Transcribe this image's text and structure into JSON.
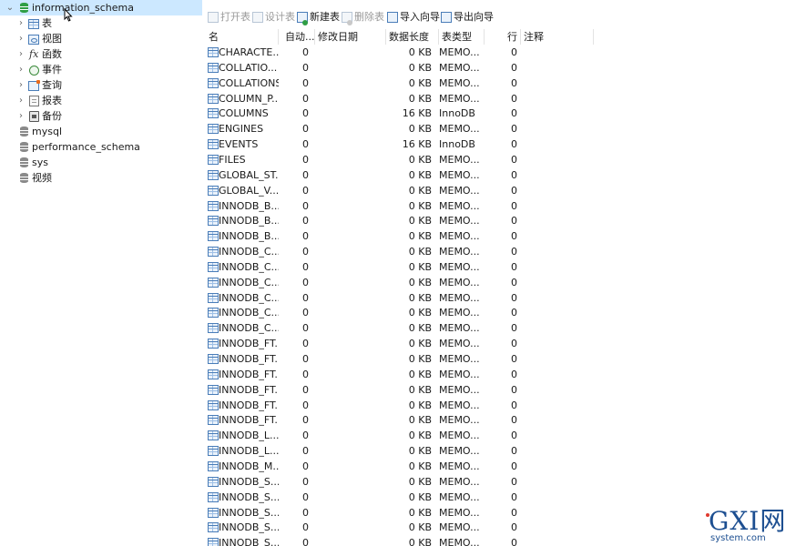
{
  "sidebar": {
    "root": "information_schema",
    "children": [
      "表",
      "视图",
      "函数",
      "事件",
      "查询",
      "报表",
      "备份"
    ],
    "databases": [
      "mysql",
      "performance_schema",
      "sys",
      "视频"
    ]
  },
  "toolbar": {
    "open_table": "打开表",
    "design_table": "设计表",
    "new_table": "新建表",
    "delete_table": "删除表",
    "import_wizard": "导入向导",
    "export_wizard": "导出向导"
  },
  "grid": {
    "columns": {
      "name": "名",
      "auto_increment": "自动...",
      "modified_date": "修改日期",
      "data_length": "数据长度",
      "engine": "表类型",
      "rows": "行",
      "comment": "注释"
    },
    "rows": [
      {
        "name": "CHARACTE...",
        "auto": "0",
        "size": "0 KB",
        "engine": "MEMO...",
        "rows": "0"
      },
      {
        "name": "COLLATIO...",
        "auto": "0",
        "size": "0 KB",
        "engine": "MEMO...",
        "rows": "0"
      },
      {
        "name": "COLLATIONS",
        "auto": "0",
        "size": "0 KB",
        "engine": "MEMO...",
        "rows": "0"
      },
      {
        "name": "COLUMN_P...",
        "auto": "0",
        "size": "0 KB",
        "engine": "MEMO...",
        "rows": "0"
      },
      {
        "name": "COLUMNS",
        "auto": "0",
        "size": "16 KB",
        "engine": "InnoDB",
        "rows": "0"
      },
      {
        "name": "ENGINES",
        "auto": "0",
        "size": "0 KB",
        "engine": "MEMO...",
        "rows": "0"
      },
      {
        "name": "EVENTS",
        "auto": "0",
        "size": "16 KB",
        "engine": "InnoDB",
        "rows": "0"
      },
      {
        "name": "FILES",
        "auto": "0",
        "size": "0 KB",
        "engine": "MEMO...",
        "rows": "0"
      },
      {
        "name": "GLOBAL_ST...",
        "auto": "0",
        "size": "0 KB",
        "engine": "MEMO...",
        "rows": "0"
      },
      {
        "name": "GLOBAL_V...",
        "auto": "0",
        "size": "0 KB",
        "engine": "MEMO...",
        "rows": "0"
      },
      {
        "name": "INNODB_B...",
        "auto": "0",
        "size": "0 KB",
        "engine": "MEMO...",
        "rows": "0"
      },
      {
        "name": "INNODB_B...",
        "auto": "0",
        "size": "0 KB",
        "engine": "MEMO...",
        "rows": "0"
      },
      {
        "name": "INNODB_B...",
        "auto": "0",
        "size": "0 KB",
        "engine": "MEMO...",
        "rows": "0"
      },
      {
        "name": "INNODB_C...",
        "auto": "0",
        "size": "0 KB",
        "engine": "MEMO...",
        "rows": "0"
      },
      {
        "name": "INNODB_C...",
        "auto": "0",
        "size": "0 KB",
        "engine": "MEMO...",
        "rows": "0"
      },
      {
        "name": "INNODB_C...",
        "auto": "0",
        "size": "0 KB",
        "engine": "MEMO...",
        "rows": "0"
      },
      {
        "name": "INNODB_C...",
        "auto": "0",
        "size": "0 KB",
        "engine": "MEMO...",
        "rows": "0"
      },
      {
        "name": "INNODB_C...",
        "auto": "0",
        "size": "0 KB",
        "engine": "MEMO...",
        "rows": "0"
      },
      {
        "name": "INNODB_C...",
        "auto": "0",
        "size": "0 KB",
        "engine": "MEMO...",
        "rows": "0"
      },
      {
        "name": "INNODB_FT...",
        "auto": "0",
        "size": "0 KB",
        "engine": "MEMO...",
        "rows": "0"
      },
      {
        "name": "INNODB_FT...",
        "auto": "0",
        "size": "0 KB",
        "engine": "MEMO...",
        "rows": "0"
      },
      {
        "name": "INNODB_FT...",
        "auto": "0",
        "size": "0 KB",
        "engine": "MEMO...",
        "rows": "0"
      },
      {
        "name": "INNODB_FT...",
        "auto": "0",
        "size": "0 KB",
        "engine": "MEMO...",
        "rows": "0"
      },
      {
        "name": "INNODB_FT...",
        "auto": "0",
        "size": "0 KB",
        "engine": "MEMO...",
        "rows": "0"
      },
      {
        "name": "INNODB_FT...",
        "auto": "0",
        "size": "0 KB",
        "engine": "MEMO...",
        "rows": "0"
      },
      {
        "name": "INNODB_L...",
        "auto": "0",
        "size": "0 KB",
        "engine": "MEMO...",
        "rows": "0"
      },
      {
        "name": "INNODB_L...",
        "auto": "0",
        "size": "0 KB",
        "engine": "MEMO...",
        "rows": "0"
      },
      {
        "name": "INNODB_M...",
        "auto": "0",
        "size": "0 KB",
        "engine": "MEMO...",
        "rows": "0"
      },
      {
        "name": "INNODB_S...",
        "auto": "0",
        "size": "0 KB",
        "engine": "MEMO...",
        "rows": "0"
      },
      {
        "name": "INNODB_S...",
        "auto": "0",
        "size": "0 KB",
        "engine": "MEMO...",
        "rows": "0"
      },
      {
        "name": "INNODB_S...",
        "auto": "0",
        "size": "0 KB",
        "engine": "MEMO...",
        "rows": "0"
      },
      {
        "name": "INNODB_S...",
        "auto": "0",
        "size": "0 KB",
        "engine": "MEMO...",
        "rows": "0"
      },
      {
        "name": "INNODB_S...",
        "auto": "0",
        "size": "0 KB",
        "engine": "MEMO...",
        "rows": "0"
      }
    ]
  },
  "watermark": {
    "big": "GXI网",
    "small": "system.com"
  },
  "icons": {
    "database": "database-icon",
    "table": "table-icon",
    "view": "view-icon",
    "function": "function-icon",
    "event": "event-icon",
    "query": "query-icon",
    "report": "report-icon",
    "backup": "backup-icon",
    "cursor": "mouse-cursor-icon"
  },
  "colors": {
    "selection": "#cce8ff",
    "active_db": "#2f9e44",
    "inactive_db": "#8a8a8a",
    "accent": "#4a7db8"
  }
}
